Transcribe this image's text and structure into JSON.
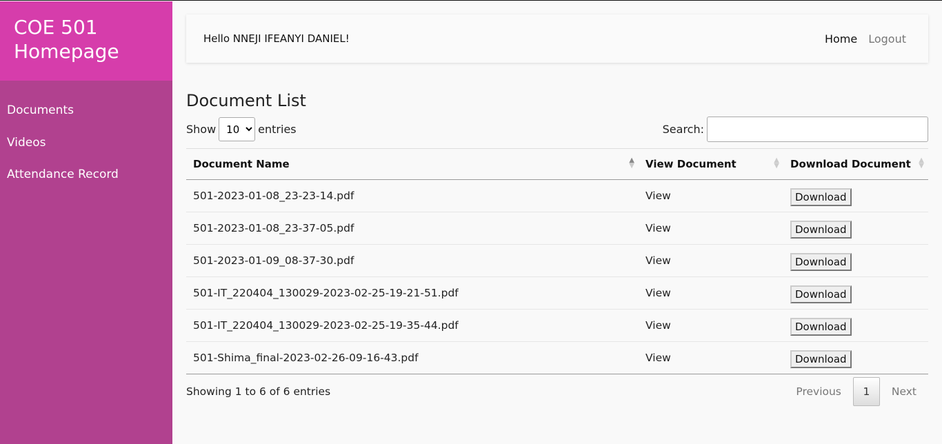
{
  "sidebar": {
    "title_line1": "COE 501",
    "title_line2": "Homepage",
    "items": [
      {
        "label": "Documents"
      },
      {
        "label": "Videos"
      },
      {
        "label": "Attendance Record"
      }
    ]
  },
  "topbar": {
    "greeting": "Hello NNEJI IFEANYI DANIEL!",
    "home": "Home",
    "logout": "Logout"
  },
  "page": {
    "title": "Document List",
    "show_label": "Show",
    "entries_label": "entries",
    "page_length": "10",
    "search_label": "Search:",
    "search_value": ""
  },
  "table": {
    "columns": [
      "Document Name",
      "View Document",
      "Download Document"
    ],
    "rows": [
      {
        "name": "501-2023-01-08_23-23-14.pdf",
        "view": "View",
        "download": "Download"
      },
      {
        "name": "501-2023-01-08_23-37-05.pdf",
        "view": "View",
        "download": "Download"
      },
      {
        "name": "501-2023-01-09_08-37-30.pdf",
        "view": "View",
        "download": "Download"
      },
      {
        "name": "501-IT_220404_130029-2023-02-25-19-21-51.pdf",
        "view": "View",
        "download": "Download"
      },
      {
        "name": "501-IT_220404_130029-2023-02-25-19-35-44.pdf",
        "view": "View",
        "download": "Download"
      },
      {
        "name": "501-Shima_final-2023-02-26-09-16-43.pdf",
        "view": "View",
        "download": "Download"
      }
    ]
  },
  "footer": {
    "info": "Showing 1 to 6 of 6 entries",
    "previous": "Previous",
    "current_page": "1",
    "next": "Next"
  }
}
